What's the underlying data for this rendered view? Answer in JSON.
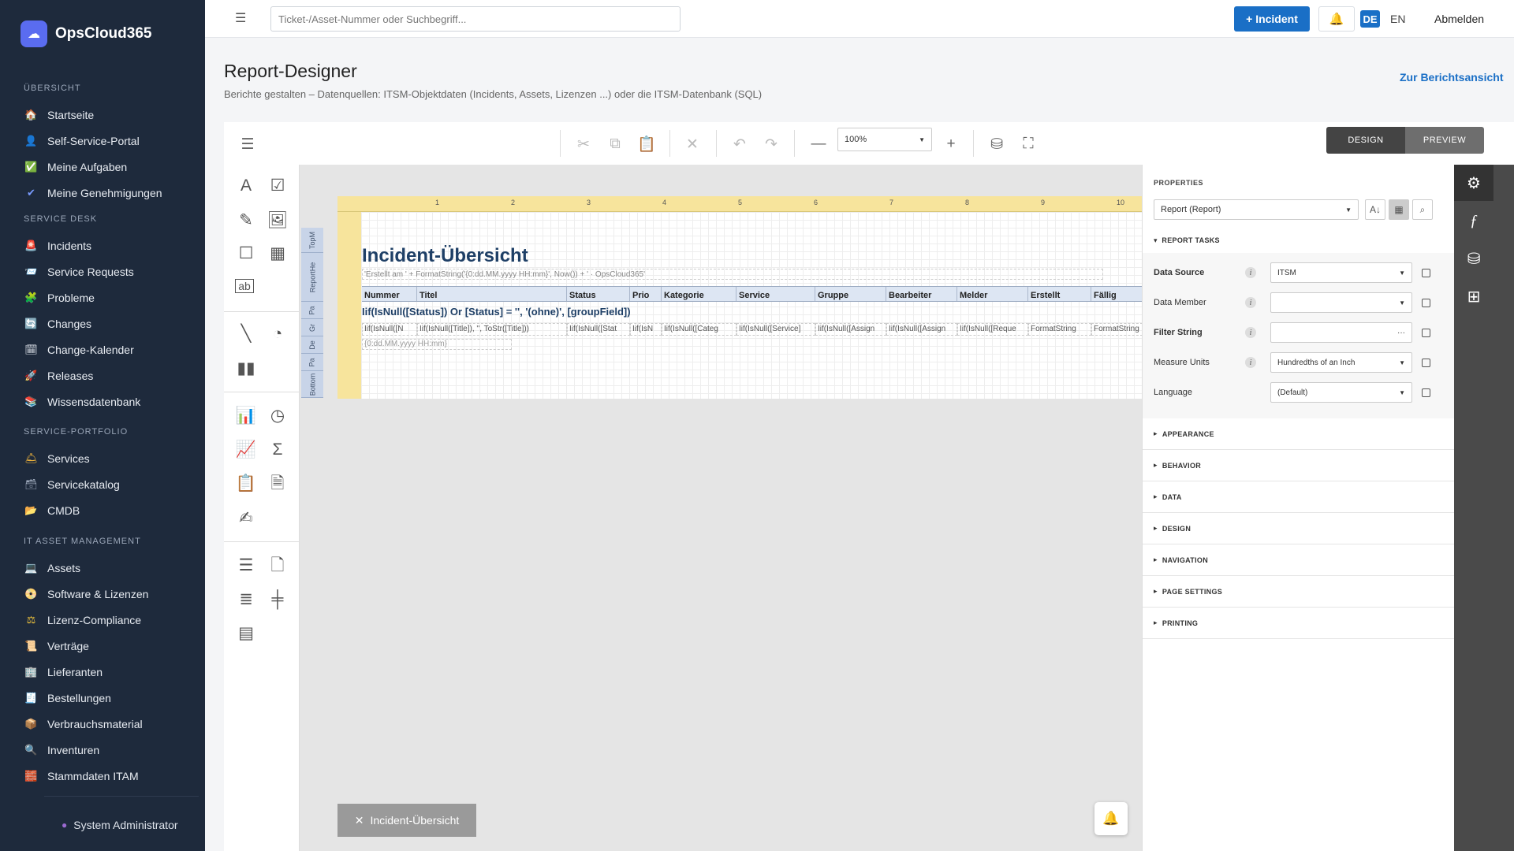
{
  "app": {
    "name": "OpsCloud365"
  },
  "sidebar": {
    "groups": [
      {
        "heading": "ÜBERSICHT",
        "items": [
          {
            "label": "Startseite",
            "icon": "home-icon",
            "color": "#f08a3c",
            "glyph": "🏠"
          },
          {
            "label": "Self-Service-Portal",
            "icon": "person-icon",
            "color": "#e8a13c",
            "glyph": "👤"
          },
          {
            "label": "Meine Aufgaben",
            "icon": "checkbox-icon",
            "color": "#2eb85c",
            "glyph": "✅"
          },
          {
            "label": "Meine Genehmigungen",
            "icon": "check-icon",
            "color": "#7a9cff",
            "glyph": "✔"
          }
        ]
      },
      {
        "heading": "SERVICE DESK",
        "items": [
          {
            "label": "Incidents",
            "icon": "alarm-icon",
            "color": "#e55353",
            "glyph": "🚨"
          },
          {
            "label": "Service Requests",
            "icon": "inbox-icon",
            "color": "#7aa5d6",
            "glyph": "📨"
          },
          {
            "label": "Probleme",
            "icon": "puzzle-icon",
            "color": "#7bc043",
            "glyph": "🧩"
          },
          {
            "label": "Changes",
            "icon": "refresh-icon",
            "color": "#3c8ce8",
            "glyph": "🔄"
          },
          {
            "label": "Change-Kalender",
            "icon": "calendar-icon",
            "color": "#dfe4ec",
            "glyph": "🗓"
          },
          {
            "label": "Releases",
            "icon": "rocket-icon",
            "color": "#e55353",
            "glyph": "🚀"
          },
          {
            "label": "Wissensdatenbank",
            "icon": "books-icon",
            "color": "#5aa0e0",
            "glyph": "📚"
          }
        ]
      },
      {
        "heading": "SERVICE-PORTFOLIO",
        "items": [
          {
            "label": "Services",
            "icon": "bell-service-icon",
            "color": "#f0b43c",
            "glyph": "🛎"
          },
          {
            "label": "Servicekatalog",
            "icon": "catalog-icon",
            "color": "#9aa6b8",
            "glyph": "🗃"
          },
          {
            "label": "CMDB",
            "icon": "folder-icon",
            "color": "#f0c43c",
            "glyph": "📂"
          }
        ]
      },
      {
        "heading": "IT ASSET MANAGEMENT",
        "items": [
          {
            "label": "Assets",
            "icon": "laptop-icon",
            "color": "#5aa0e0",
            "glyph": "💻"
          },
          {
            "label": "Software & Lizenzen",
            "icon": "disc-icon",
            "color": "#f0b43c",
            "glyph": "📀"
          },
          {
            "label": "Lizenz-Compliance",
            "icon": "scales-icon",
            "color": "#f0c43c",
            "glyph": "⚖"
          },
          {
            "label": "Verträge",
            "icon": "contract-icon",
            "color": "#e8d4a0",
            "glyph": "📜"
          },
          {
            "label": "Lieferanten",
            "icon": "building-icon",
            "color": "#b0b8c4",
            "glyph": "🏢"
          },
          {
            "label": "Bestellungen",
            "icon": "receipt-icon",
            "color": "#e8e8e8",
            "glyph": "🧾"
          },
          {
            "label": "Verbrauchsmaterial",
            "icon": "box-icon",
            "color": "#d4a060",
            "glyph": "📦"
          },
          {
            "label": "Inventuren",
            "icon": "magnifier-icon",
            "color": "#5aa0e0",
            "glyph": "🔍"
          },
          {
            "label": "Stammdaten ITAM",
            "icon": "bricks-icon",
            "color": "#e07040",
            "glyph": "🧱"
          }
        ]
      }
    ],
    "user": "System Administrator"
  },
  "topbar": {
    "search_placeholder": "Ticket-/Asset-Nummer oder Suchbegriff...",
    "incident_button": "+ Incident",
    "lang_de": "DE",
    "lang_en": "EN",
    "logout": "Abmelden"
  },
  "page": {
    "title": "Report-Designer",
    "subtitle": "Berichte gestalten – Datenquellen: ITSM-Objektdaten (Incidents, Assets, Lizenzen ...) oder die ITSM-Datenbank (SQL)",
    "report_view_link": "Zur Berichtsansicht"
  },
  "designer": {
    "zoom": "100%",
    "mode_design": "DESIGN",
    "mode_preview": "PREVIEW",
    "ruler_ticks": [
      "1",
      "2",
      "3",
      "4",
      "5",
      "6",
      "7",
      "8",
      "9",
      "10"
    ],
    "bands": [
      "TopM",
      "ReportHe",
      "Pa",
      "Gr",
      "De",
      "Pa",
      "Bottom"
    ],
    "report_title": "Incident-Übersicht",
    "report_formula": "'Erstellt am ' + FormatString('{0:dd.MM.yyyy HH:mm}', Now()) + ' · OpsCloud365'",
    "columns": [
      "Nummer",
      "Titel",
      "Status",
      "Prio",
      "Kategorie",
      "Service",
      "Gruppe",
      "Bearbeiter",
      "Melder",
      "Erstellt",
      "Fällig"
    ],
    "group_field": "Iif(IsNull([Status]) Or [Status] = '', '(ohne)', [groupField])",
    "detail_cells": [
      "Iif(IsNull([N",
      "Iif(IsNull([Title]), '', ToStr([Title]))",
      "Iif(IsNull([Stat",
      "Iif(IsN",
      "Iif(IsNull([Categ",
      "Iif(IsNull([Service]",
      "Iif(IsNull([Assign",
      "Iif(IsNull([Assign",
      "Iif(IsNull([Reque",
      "FormatString",
      "FormatString"
    ],
    "footer_formula": "{0:dd.MM.yyyy HH:mm}",
    "open_tab": "Incident-Übersicht"
  },
  "properties": {
    "heading": "PROPERTIES",
    "selected": "Report (Report)",
    "tasks_heading": "REPORT TASKS",
    "rows": [
      {
        "label": "Data Source",
        "value": "ITSM",
        "bold": true,
        "control": "dropdown"
      },
      {
        "label": "Data Member",
        "value": "",
        "bold": false,
        "control": "dropdown"
      },
      {
        "label": "Filter String",
        "value": "",
        "bold": true,
        "control": "ellipsis"
      },
      {
        "label": "Measure Units",
        "value": "Hundredths of an Inch",
        "bold": false,
        "control": "dropdown"
      },
      {
        "label": "Language",
        "value": "(Default)",
        "bold": false,
        "control": "dropdown"
      }
    ],
    "sections": [
      "APPEARANCE",
      "BEHAVIOR",
      "DATA",
      "DESIGN",
      "NAVIGATION",
      "PAGE SETTINGS",
      "PRINTING"
    ]
  },
  "colors": {
    "sidebar": "#1e2a3c",
    "accent": "#1a6fc6",
    "report_title": "#1e3f66"
  }
}
